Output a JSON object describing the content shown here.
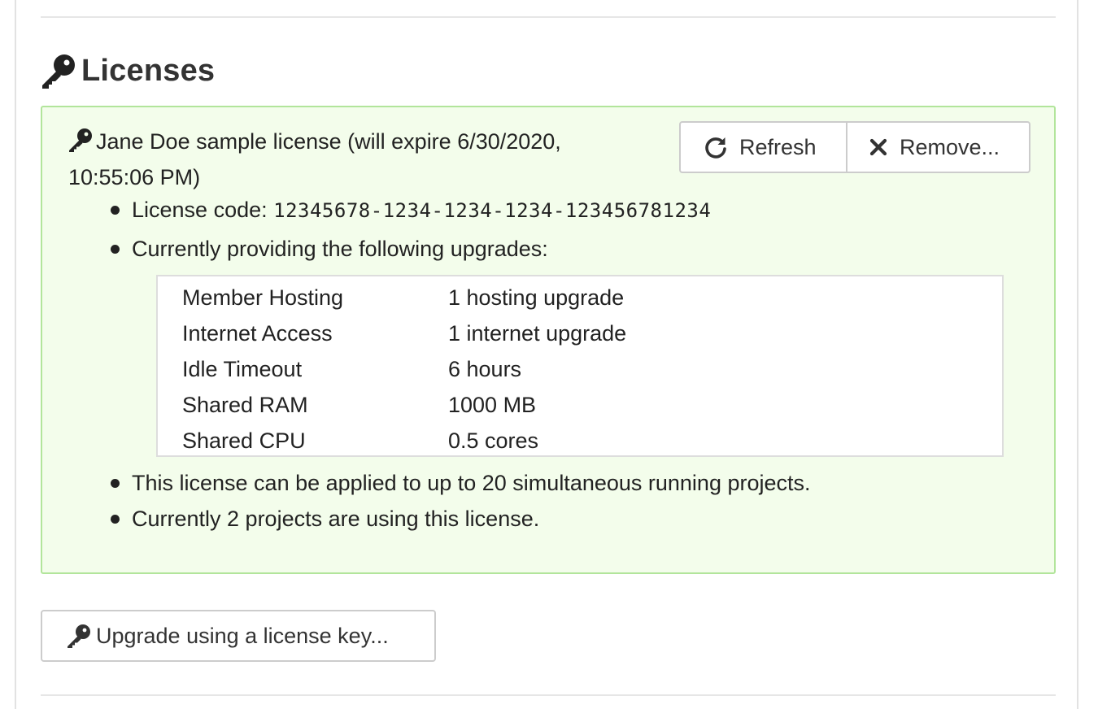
{
  "section": {
    "title": "Licenses",
    "icon": "key-icon"
  },
  "license": {
    "title": "Jane Doe sample license (will expire 6/30/2020, 10:55:06 PM)",
    "code_label": "License code: ",
    "code_value": "12345678-1234-1234-1234-123456781234",
    "upgrades_intro": "Currently providing the following upgrades:",
    "upgrades": [
      {
        "name": "Member Hosting",
        "value": "1 hosting upgrade"
      },
      {
        "name": "Internet Access",
        "value": "1 internet upgrade"
      },
      {
        "name": "Idle Timeout",
        "value": "6 hours"
      },
      {
        "name": "Shared RAM",
        "value": "1000 MB"
      },
      {
        "name": "Shared CPU",
        "value": "0.5 cores"
      }
    ],
    "limit_text": "This license can be applied to up to 20 simultaneous running projects.",
    "usage_text": "Currently 2 projects are using this license."
  },
  "buttons": {
    "refresh_label": "Refresh",
    "refresh_icon": "refresh-icon",
    "remove_label": "Remove...",
    "remove_icon": "close-icon",
    "upgrade_key_label": "Upgrade using a license key...",
    "upgrade_key_icon": "key-icon"
  },
  "colors": {
    "license_bg": "#f3fdeb",
    "license_border": "#b2e59b",
    "text": "#333333"
  }
}
